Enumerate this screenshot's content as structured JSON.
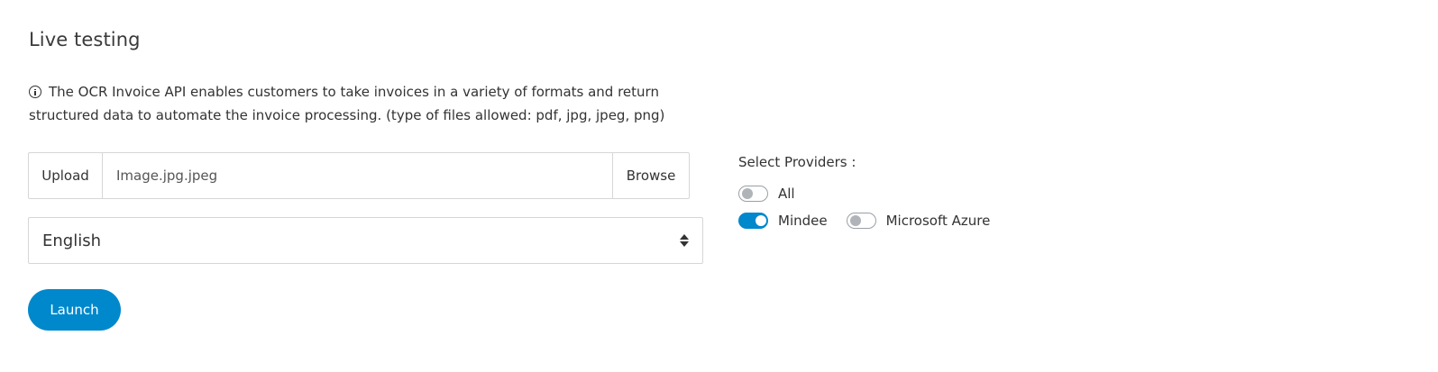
{
  "page": {
    "title": "Live testing",
    "info_text": "The OCR Invoice API enables customers to take invoices in a variety of formats and return structured data to automate the invoice processing. (type of files allowed: pdf, jpg, jpeg, png)"
  },
  "upload": {
    "label": "Upload",
    "file_name": "Image.jpg.jpeg",
    "browse_label": "Browse"
  },
  "language": {
    "selected": "English"
  },
  "launch": {
    "label": "Launch"
  },
  "providers": {
    "label": "Select Providers :",
    "items": [
      {
        "name": "All",
        "enabled": false
      },
      {
        "name": "Mindee",
        "enabled": true
      },
      {
        "name": "Microsoft Azure",
        "enabled": false
      }
    ]
  },
  "colors": {
    "accent": "#0088cc"
  }
}
